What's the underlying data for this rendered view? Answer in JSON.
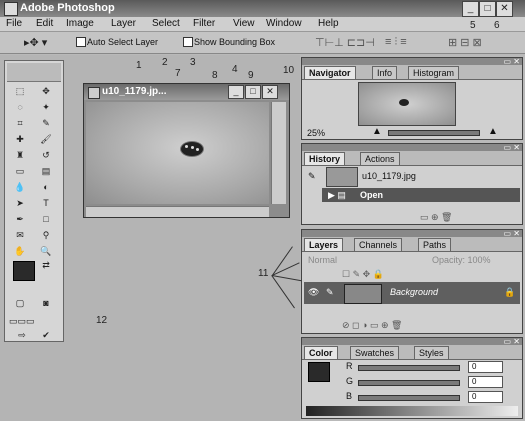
{
  "app": {
    "title": "Adobe Photoshop",
    "window_buttons": [
      "_",
      "□",
      "✕"
    ]
  },
  "menu": [
    "File",
    "Edit",
    "Image",
    "Layer",
    "Select",
    "Filter",
    "View",
    "Window",
    "Help"
  ],
  "options_bar": {
    "auto_select": "Auto Select Layer",
    "bounding_box": "Show Bounding Box"
  },
  "callouts": [
    "1",
    "2",
    "3",
    "4",
    "5",
    "6",
    "7",
    "8",
    "9",
    "10",
    "11",
    "12"
  ],
  "document": {
    "title": "u10_1179.jp..."
  },
  "navigator": {
    "tabs": [
      "Navigator",
      "Info",
      "Histogram"
    ],
    "zoom": "25%"
  },
  "history": {
    "tabs": [
      "History",
      "Actions"
    ],
    "snapshot": "u10_1179.jpg",
    "state": "Open"
  },
  "layers": {
    "tabs": [
      "Layers",
      "Channels",
      "Paths"
    ],
    "blend": "Normal",
    "opacity_label": "Opacity: 100%",
    "layer_name": "Background"
  },
  "color": {
    "tabs": [
      "Color",
      "Swatches",
      "Styles"
    ],
    "channels": [
      "R",
      "G",
      "B"
    ],
    "values": [
      "0",
      "0",
      "0"
    ]
  }
}
